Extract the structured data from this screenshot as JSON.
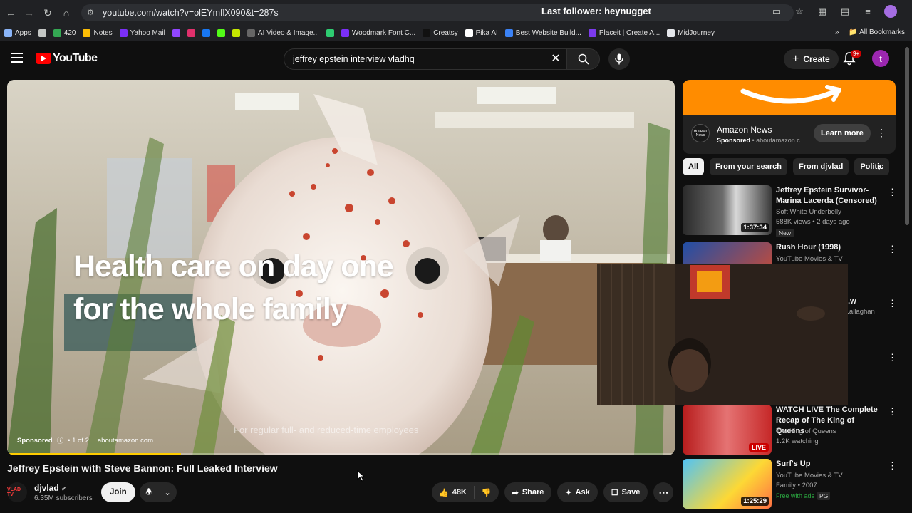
{
  "browser": {
    "url": "youtube.com/watch?v=olEYmflX090&t=287s",
    "overlay_text": "Last follower: heynugget"
  },
  "bookmarks": [
    {
      "label": "Apps",
      "color": "#8ab4f8"
    },
    {
      "label": "",
      "color": "#c4c7c5"
    },
    {
      "label": "420",
      "color": "#34a853"
    },
    {
      "label": "Notes",
      "color": "#fbbc05"
    },
    {
      "label": "Yahoo Mail",
      "color": "#7b2ff7"
    },
    {
      "label": "",
      "color": "#9146ff"
    },
    {
      "label": "",
      "color": "#e1306c"
    },
    {
      "label": "",
      "color": "#1877f2"
    },
    {
      "label": "",
      "color": "#53fc18"
    },
    {
      "label": "",
      "color": "#c5e600"
    },
    {
      "label": "AI Video & Image...",
      "color": "#666666"
    },
    {
      "label": "",
      "color": "#2ecc71"
    },
    {
      "label": "Woodmark Font C...",
      "color": "#7b2ff7"
    },
    {
      "label": "Creatsy",
      "color": "#111111"
    },
    {
      "label": "Pika AI",
      "color": "#ffffff"
    },
    {
      "label": "Best Website Build...",
      "color": "#3b82f6"
    },
    {
      "label": "Placeit | Create A...",
      "color": "#7c3aed"
    },
    {
      "label": "MidJourney",
      "color": "#e5e7eb"
    }
  ],
  "bookmarks_right": {
    "all_bookmarks": "All Bookmarks"
  },
  "header": {
    "logo_text": "YouTube",
    "search_value": "jeffrey epstein interview vladhq",
    "create_label": "Create",
    "notif_count": "9+",
    "avatar_letter": "t"
  },
  "player": {
    "headline_line1": "Health care on day one",
    "headline_line2": "for the whole family",
    "caption": "For regular full- and reduced-time employees",
    "ad_label": "Sponsored",
    "ad_count": "1 of 2",
    "ad_domain": "aboutamazon.com",
    "ad_progress": 0.26
  },
  "video": {
    "title": "Jeffrey Epstein with Steve Bannon: Full Leaked Interview",
    "channel": "djvlad",
    "subscribers": "6.35M subscribers",
    "channel_logo": "VLAD TV",
    "join": "Join",
    "likes": "48K",
    "share": "Share",
    "ask": "Ask",
    "save": "Save"
  },
  "sidebar_ad": {
    "name": "Amazon News",
    "sponsored": "Sponsored",
    "domain": "aboutamazon.c...",
    "logo_text": "Amazon News",
    "cta": "Learn more"
  },
  "chips": [
    "All",
    "From your search",
    "From djvlad",
    "Politic"
  ],
  "recommendations": [
    {
      "title": "Jeffrey Epstein Survivor-Marina Lacerda (Censored)",
      "channel": "Soft White Underbelly",
      "meta": "588K views • 2 days ago",
      "duration": "1:37:34",
      "badge": "New"
    },
    {
      "title": "Rush Hour (1998)",
      "channel": "YouTube Movies & TV",
      "meta": "",
      "duration": "",
      "badge": ""
    },
    {
      "title": "...w",
      "channel": "...allaghan",
      "meta": "",
      "duration": "",
      "badge": ""
    },
    {
      "title": "",
      "channel": "",
      "meta": "",
      "duration": "",
      "badge": ""
    },
    {
      "title": "WATCH LIVE The Complete Recap of The King of Queens",
      "channel": "The King of Queens",
      "meta": "1.2K watching",
      "duration": "",
      "badge": "LIVE"
    },
    {
      "title": "Surf's Up",
      "channel": "YouTube Movies & TV",
      "meta": "Family • 2007",
      "duration": "1:25:29",
      "free": "Free with ads",
      "rating": "PG"
    }
  ]
}
